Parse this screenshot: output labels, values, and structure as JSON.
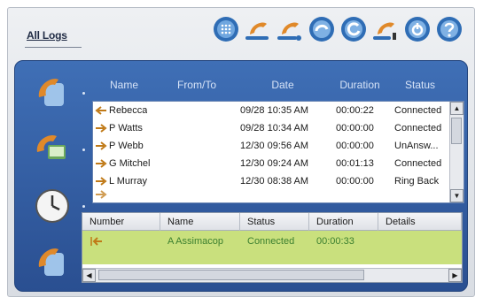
{
  "header": {
    "title": "All Logs"
  },
  "toolbar": {
    "buttons": [
      {
        "icon": "dialpad-icon"
      },
      {
        "icon": "add-contact-icon"
      },
      {
        "icon": "edit-contact-icon"
      },
      {
        "icon": "phone-refresh-icon"
      },
      {
        "icon": "phone-redial-icon"
      },
      {
        "icon": "contact-details-icon"
      },
      {
        "icon": "power-icon"
      },
      {
        "icon": "help-icon"
      }
    ]
  },
  "nav": {
    "items": [
      {
        "icon": "phone-icon"
      },
      {
        "icon": "phone-computer-icon"
      },
      {
        "icon": "clock-icon"
      },
      {
        "icon": "phone-contact-icon"
      }
    ]
  },
  "logs": {
    "columns": {
      "name": "Name",
      "from": "From/To",
      "date": "Date",
      "duration": "Duration",
      "status": "Status"
    },
    "rows": [
      {
        "direction": "incoming",
        "name": "Rebecca",
        "from": "",
        "date": "09/28  10:35 AM",
        "duration": "00:00:22",
        "status": "Connected"
      },
      {
        "direction": "outgoing",
        "name": "P Watts",
        "from": "",
        "date": "09/28  10:34 AM",
        "duration": "00:00:00",
        "status": "Connected"
      },
      {
        "direction": "outgoing",
        "name": "P Webb",
        "from": "",
        "date": "12/30  09:56 AM",
        "duration": "00:00:00",
        "status": "UnAnsw..."
      },
      {
        "direction": "outgoing",
        "name": "G Mitchel",
        "from": "",
        "date": "12/30  09:24 AM",
        "duration": "00:01:13",
        "status": "Connected"
      },
      {
        "direction": "outgoing",
        "name": "L Murray",
        "from": "",
        "date": "12/30  08:38 AM",
        "duration": "00:00:00",
        "status": "Ring Back"
      }
    ]
  },
  "calls": {
    "columns": {
      "number": "Number",
      "name": "Name",
      "status": "Status",
      "duration": "Duration",
      "details": "Details"
    },
    "active": {
      "number": "",
      "name": "A Assimacop",
      "status": "Connected",
      "duration": "00:00:33",
      "details": ""
    }
  },
  "colors": {
    "panel": "#3f6fb6",
    "active_row": "#c9e07d",
    "active_text": "#3b7f2f"
  }
}
